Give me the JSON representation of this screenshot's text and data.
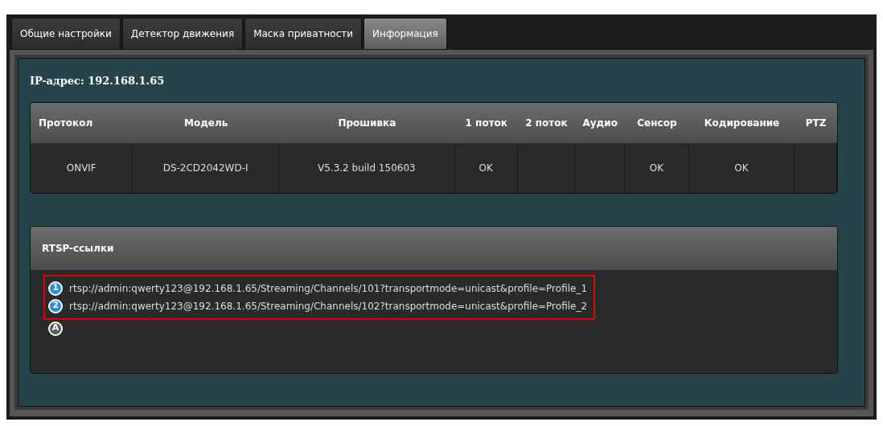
{
  "tabs": [
    {
      "label": "Общие настройки",
      "selected": false
    },
    {
      "label": "Детектор движения",
      "selected": false
    },
    {
      "label": "Маска приватности",
      "selected": false
    },
    {
      "label": "Информация",
      "selected": true
    }
  ],
  "ip_label": "IP-адрес: 192.168.1.65",
  "table": {
    "columns": [
      "Протокол",
      "Модель",
      "Прошивка",
      "1 поток",
      "2 поток",
      "Аудио",
      "Сенсор",
      "Кодирование",
      "PTZ"
    ],
    "rows": [
      [
        "ONVIF",
        "DS-2CD2042WD-I",
        "V5.3.2 build 150603",
        "OK",
        "",
        "",
        "OK",
        "OK",
        ""
      ]
    ]
  },
  "rtsp": {
    "title": "RTSP-ссылки",
    "highlighted": true,
    "links": [
      {
        "badge": "1",
        "url": "rtsp://admin:qwerty123@192.168.1.65/Streaming/Channels/101?transportmode=unicast&profile=Profile_1",
        "color": "#2a8fd6"
      },
      {
        "badge": "2",
        "url": "rtsp://admin:qwerty123@192.168.1.65/Streaming/Channels/102?transportmode=unicast&profile=Profile_2",
        "color": "#2a8fd6"
      },
      {
        "badge": "A",
        "color": "#5a5a5a"
      }
    ]
  }
}
